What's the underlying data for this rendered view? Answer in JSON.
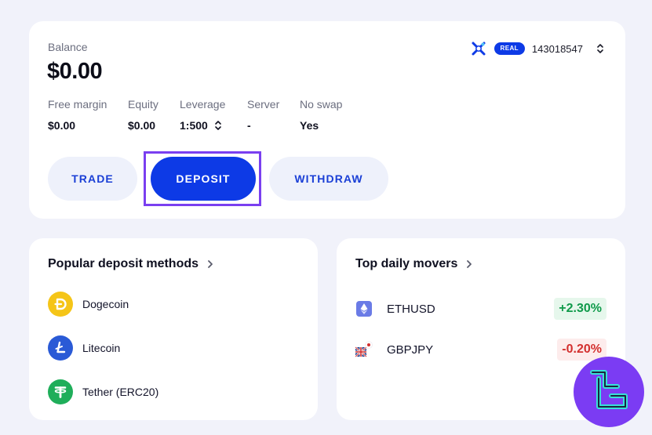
{
  "account": {
    "balance_label": "Balance",
    "balance_value": "$0.00",
    "badge": "REAL",
    "account_number": "143018547",
    "stats": [
      {
        "label": "Free margin",
        "value": "$0.00"
      },
      {
        "label": "Equity",
        "value": "$0.00"
      },
      {
        "label": "Leverage",
        "value": "1:500"
      },
      {
        "label": "Server",
        "value": "-"
      },
      {
        "label": "No swap",
        "value": "Yes"
      }
    ],
    "buttons": {
      "trade": "TRADE",
      "deposit": "DEPOSIT",
      "withdraw": "WITHDRAW"
    }
  },
  "deposit_methods": {
    "title": "Popular deposit methods",
    "items": [
      {
        "name": "Dogecoin",
        "icon": "dogecoin-icon",
        "color": "#f5c518"
      },
      {
        "name": "Litecoin",
        "icon": "litecoin-icon",
        "color": "#2a5ad6"
      },
      {
        "name": "Tether (ERC20)",
        "icon": "tether-icon",
        "color": "#1fae5a"
      }
    ]
  },
  "movers": {
    "title": "Top daily movers",
    "items": [
      {
        "symbol": "ETHUSD",
        "change": "+2.30%",
        "direction": "up",
        "icon": "ethereum-icon"
      },
      {
        "symbol": "GBPJPY",
        "change": "-0.20%",
        "direction": "down",
        "icon": "gbp-jpy-flags-icon"
      }
    ]
  },
  "colors": {
    "primary": "#0d3ae6",
    "highlight": "#7a3ff0",
    "positive": "#0f9a4a",
    "negative": "#d3302f"
  }
}
